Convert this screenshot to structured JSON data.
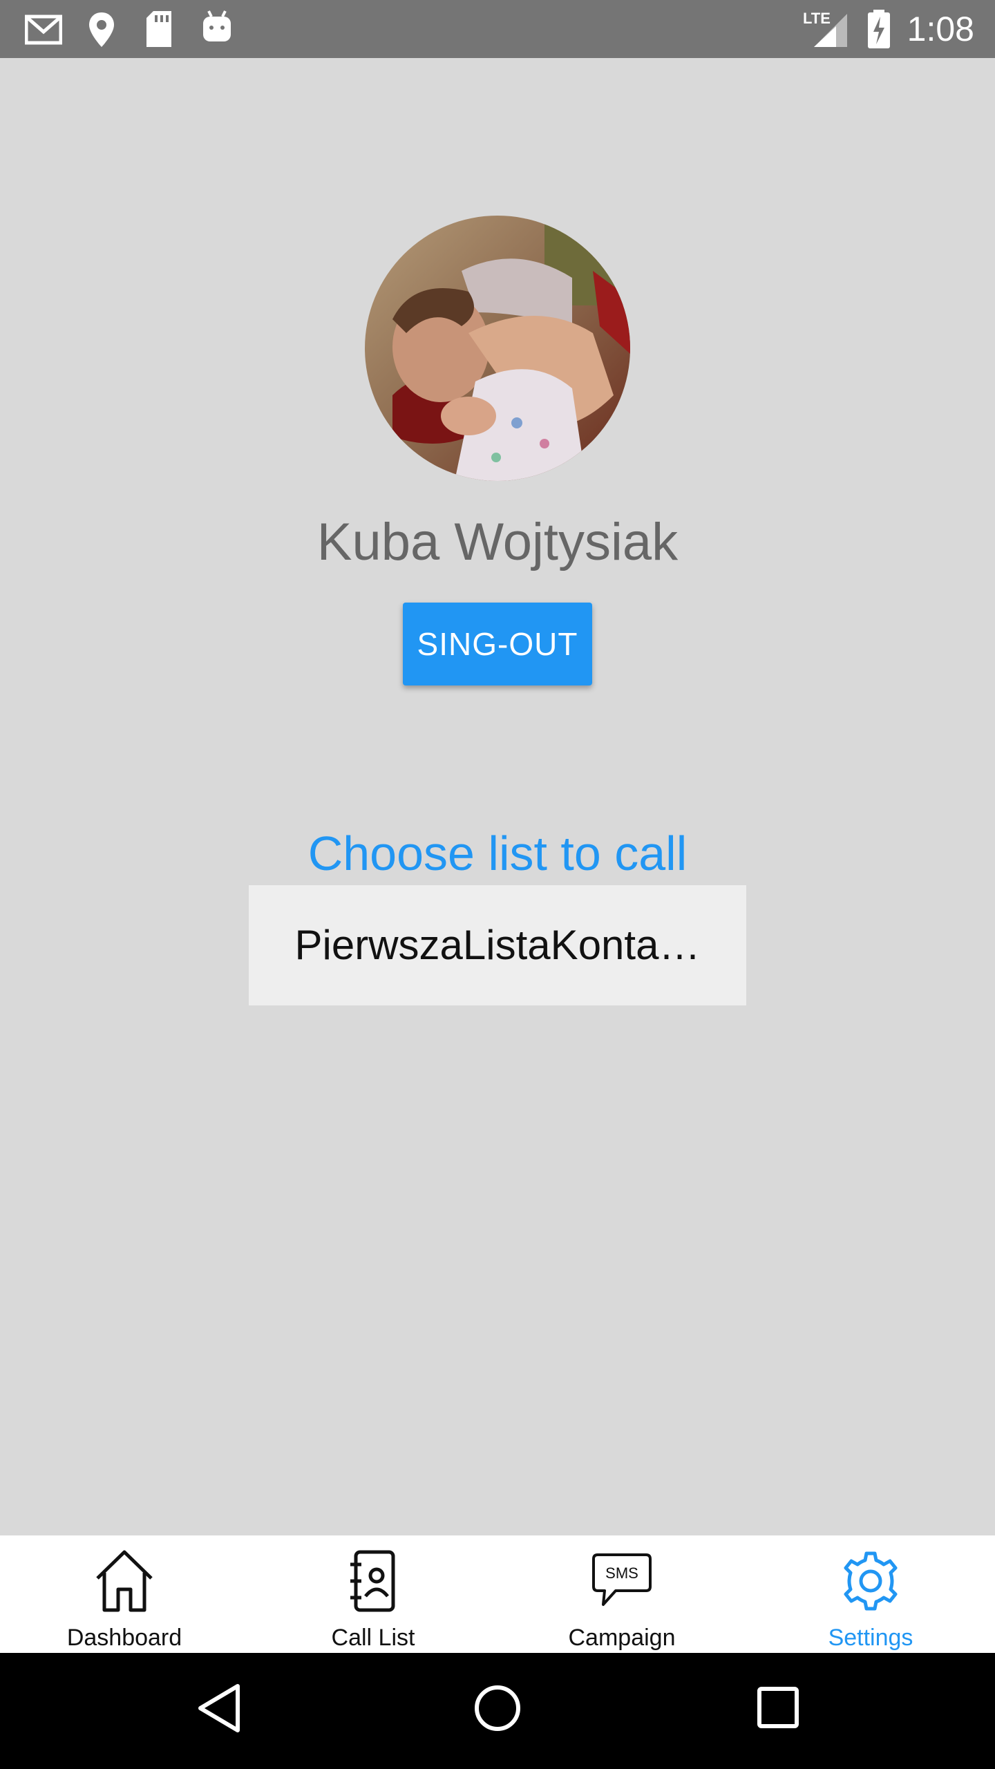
{
  "status_bar": {
    "time": "1:08",
    "icons": [
      "gmail-icon",
      "location-icon",
      "sd-card-icon",
      "android-icon",
      "lte-signal-icon",
      "battery-charging-icon"
    ],
    "network": "LTE"
  },
  "profile": {
    "name": "Kuba Wojtysiak",
    "signout_label": "SING-OUT"
  },
  "call_list": {
    "title": "Choose list to call",
    "selected": "PierwszaListaKonta…"
  },
  "tabs": [
    {
      "label": "Dashboard",
      "icon": "home-icon"
    },
    {
      "label": "Call List",
      "icon": "contacts-book-icon"
    },
    {
      "label": "Campaign",
      "icon": "sms-bubble-icon",
      "icon_text": "SMS"
    },
    {
      "label": "Settings",
      "icon": "gear-icon",
      "active": true
    }
  ],
  "colors": {
    "accent": "#2196f3",
    "background": "#d9d9d9",
    "status_bar": "#757575"
  }
}
